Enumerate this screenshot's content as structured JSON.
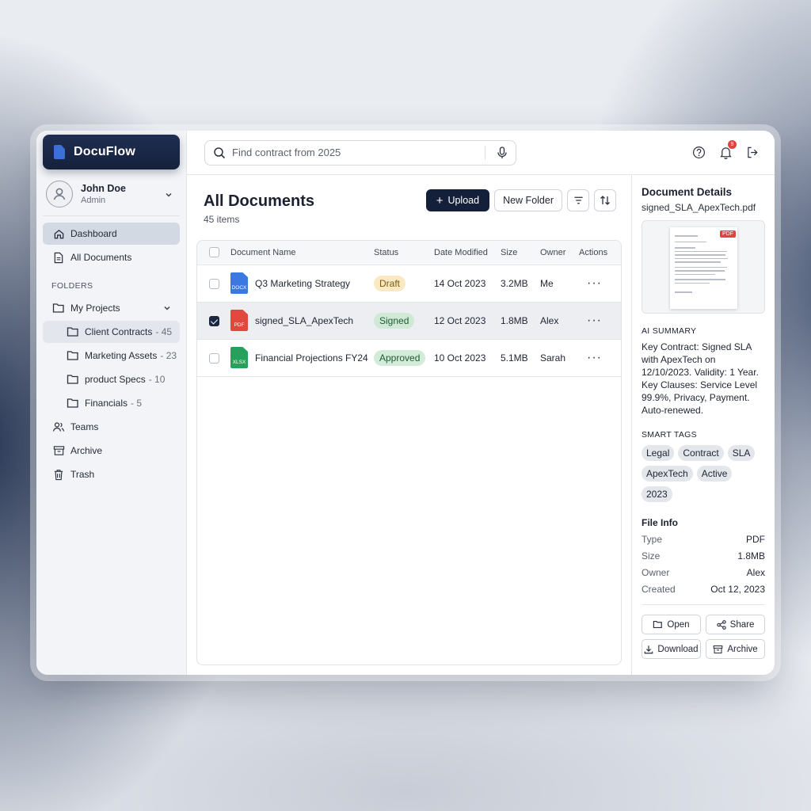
{
  "app": {
    "name": "DocuFlow"
  },
  "user": {
    "name": "John Doe",
    "role": "Admin"
  },
  "nav": {
    "dashboard": "Dashboard",
    "all_documents": "All Documents",
    "teams": "Teams",
    "archive": "Archive",
    "trash": "Trash"
  },
  "folders": {
    "section_label": "FOLDERS",
    "parent": "My Projects",
    "items": [
      {
        "name": "Client Contracts",
        "count": "- 45"
      },
      {
        "name": "Marketing Assets",
        "count": "- 23"
      },
      {
        "name": "product Specs",
        "count": "- 10"
      },
      {
        "name": "Financials",
        "count": "- 5"
      }
    ]
  },
  "search": {
    "placeholder": "Find contract from 2025"
  },
  "notifications": {
    "count": "9"
  },
  "docs": {
    "title": "All Documents",
    "count": "45 items",
    "upload_label": "Upload",
    "new_folder_label": "New Folder",
    "columns": [
      "Document Name",
      "Status",
      "Date Modified",
      "Size",
      "Owner",
      "Actions"
    ],
    "rows": [
      {
        "name": "Q3 Marketing Strategy",
        "type": "DOCX",
        "type_color": "#3b78e0",
        "status": "Draft",
        "status_bg": "#fbe9c4",
        "status_fg": "#7a5a12",
        "date": "14 Oct 2023",
        "size": "3.2MB",
        "owner": "Me",
        "selected": false,
        "actions": "···"
      },
      {
        "name": "signed_SLA_ApexTech",
        "type": "PDF",
        "type_color": "#e2483d",
        "status": "Signed",
        "status_bg": "#cfe9d6",
        "status_fg": "#1f5a33",
        "date": "12 Oct 2023",
        "size": "1.8MB",
        "owner": "Alex",
        "selected": true,
        "actions": "···"
      },
      {
        "name": "Financial Projections FY24",
        "type": "XLSX",
        "type_color": "#26a05a",
        "status": "Approved",
        "status_bg": "#d3ecd9",
        "status_fg": "#1f5a33",
        "date": "10 Oct 2023",
        "size": "5.1MB",
        "owner": "Sarah",
        "selected": false,
        "actions": "···"
      }
    ]
  },
  "details": {
    "title": "Document Details",
    "filename": "signed_SLA_ApexTech.pdf",
    "preview_tag": "PDF",
    "ai_summary_label": "AI SUMMARY",
    "ai_summary": "Key Contract: Signed SLA with ApexTech on 12/10/2023. Validity: 1 Year. Key Clauses: Service Level 99.9%, Privacy, Payment. Auto-renewed.",
    "smart_tags_label": "SMART TAGS",
    "tags": [
      "Legal",
      "Contract",
      "SLA",
      "ApexTech",
      "Active",
      "2023"
    ],
    "file_info_label": "File Info",
    "file_info": [
      {
        "k": "Type",
        "v": "PDF"
      },
      {
        "k": "Size",
        "v": "1.8MB"
      },
      {
        "k": "Owner",
        "v": "Alex"
      },
      {
        "k": "Created",
        "v": "Oct 12, 2023"
      }
    ],
    "buttons": {
      "open": "Open",
      "share": "Share",
      "download": "Download",
      "archive": "Archive"
    }
  }
}
